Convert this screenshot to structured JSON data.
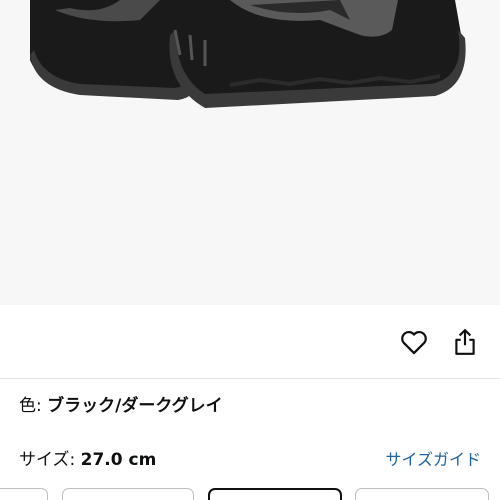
{
  "product_image": {
    "alt": "",
    "colors": {
      "sole": "#3a3a3a",
      "upper": "#1a1a1a",
      "accent": "#5a5a5a"
    }
  },
  "actions": {
    "favorite_icon": "heart-outline-icon",
    "share_icon": "share-icon"
  },
  "variation": {
    "color_label": "色:",
    "color_value": "ブラック/ダークグレイ",
    "size_label": "サイズ:",
    "size_value": "27.0 cm",
    "size_guide_link": "サイズガイド"
  },
  "size_options": [
    {
      "selected": false
    },
    {
      "selected": false
    },
    {
      "selected": false
    },
    {
      "selected": true
    },
    {
      "selected": false
    }
  ],
  "colors": {
    "link": "#2162a1",
    "text": "#0f1111",
    "divider": "#e3e6e6"
  }
}
